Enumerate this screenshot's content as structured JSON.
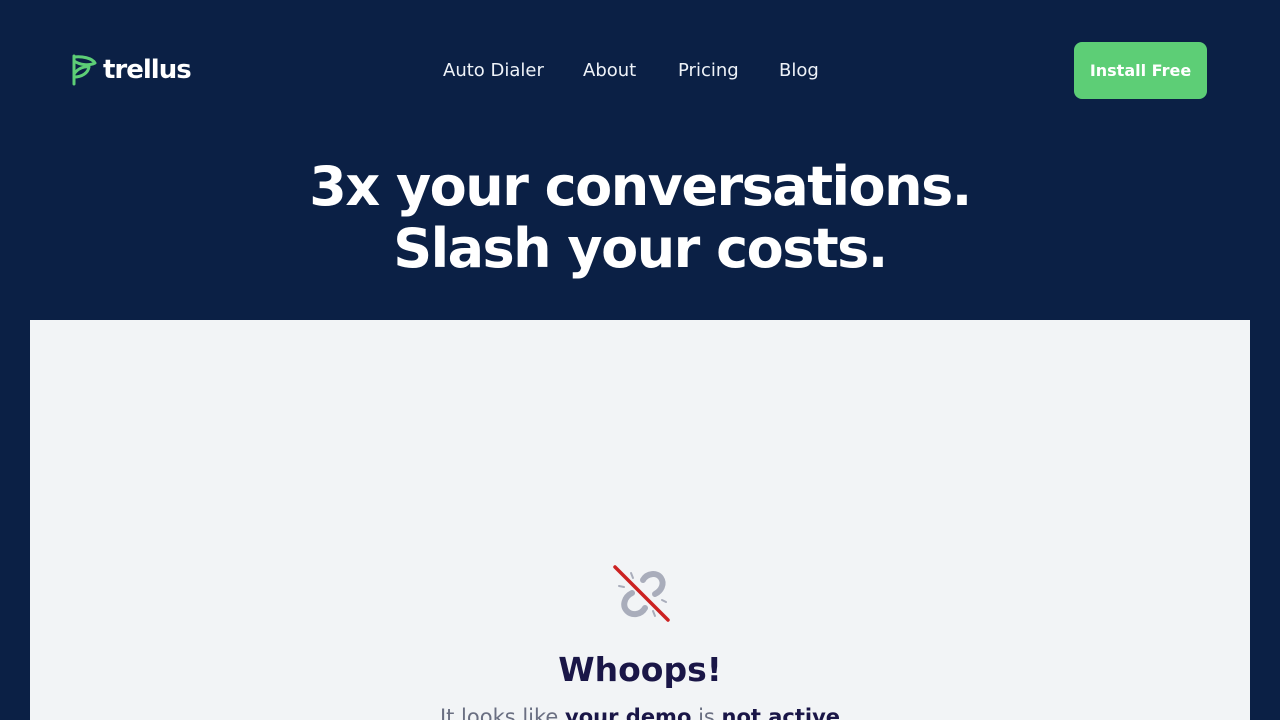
{
  "header": {
    "logo_text": "trellus",
    "nav": [
      {
        "label": "Auto Dialer"
      },
      {
        "label": "About"
      },
      {
        "label": "Pricing"
      },
      {
        "label": "Blog"
      }
    ],
    "install_label": "Install Free"
  },
  "hero": {
    "line1": "3x your conversations.",
    "line2": "Slash your costs."
  },
  "error": {
    "icon": "broken-link-icon",
    "title": "Whoops!",
    "msg_prefix": "It looks like",
    "msg_bold1": "your demo",
    "msg_middle": "is",
    "msg_bold2": "not active"
  },
  "colors": {
    "background": "#0b2045",
    "accent": "#5dce76",
    "panel": "#f2f4f6",
    "heading": "#1a1647",
    "error_red": "#cc2222"
  }
}
